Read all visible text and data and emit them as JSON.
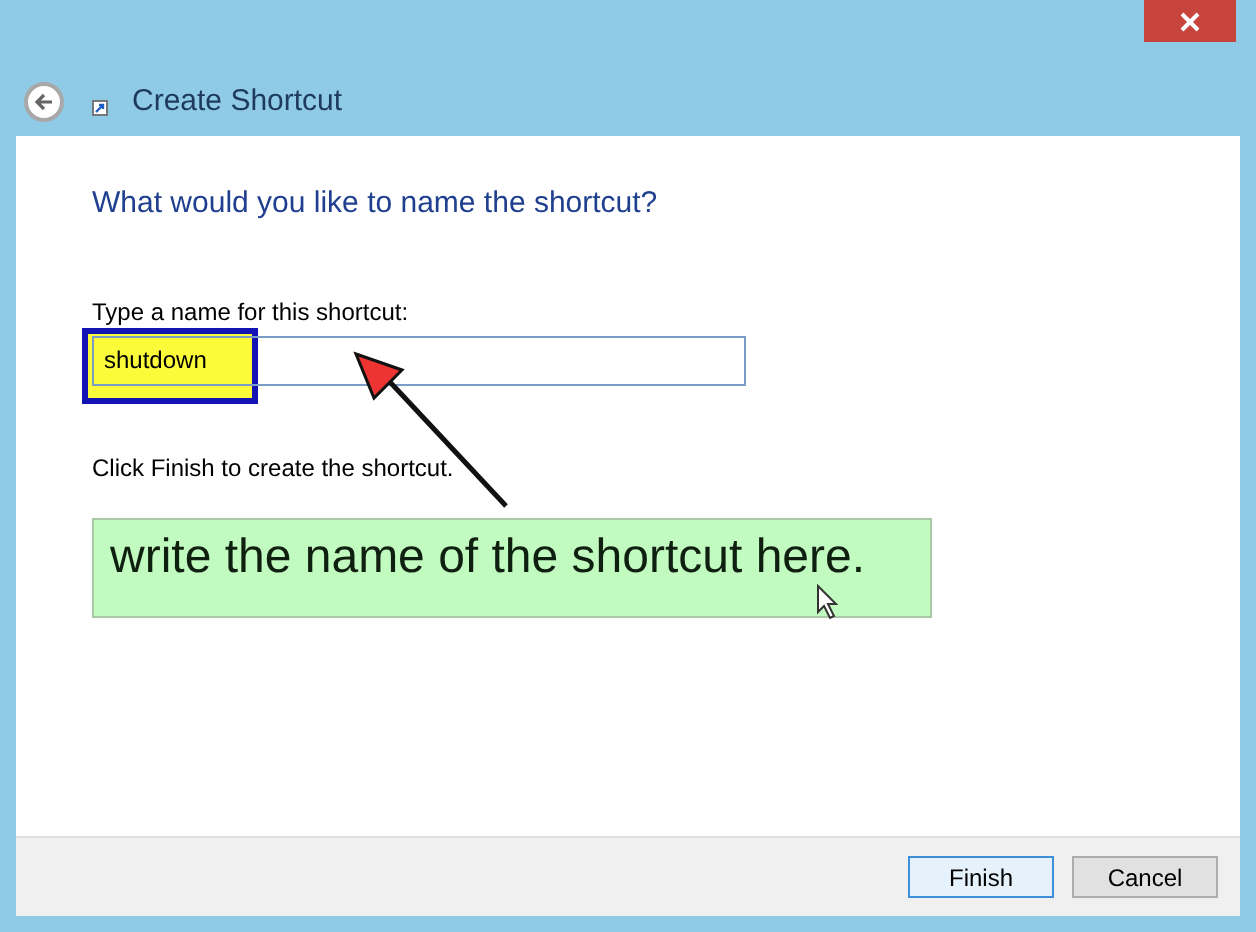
{
  "window": {
    "title": "Create Shortcut"
  },
  "heading": "What would you like to name the shortcut?",
  "name_field": {
    "label": "Type a name for this shortcut:",
    "value": "shutdown"
  },
  "instruction": "Click Finish to create the shortcut.",
  "annotation": {
    "text": "write the name of the shortcut here."
  },
  "buttons": [
    {
      "label": "Finish",
      "selected": true
    },
    {
      "label": "Cancel",
      "selected": false
    }
  ]
}
